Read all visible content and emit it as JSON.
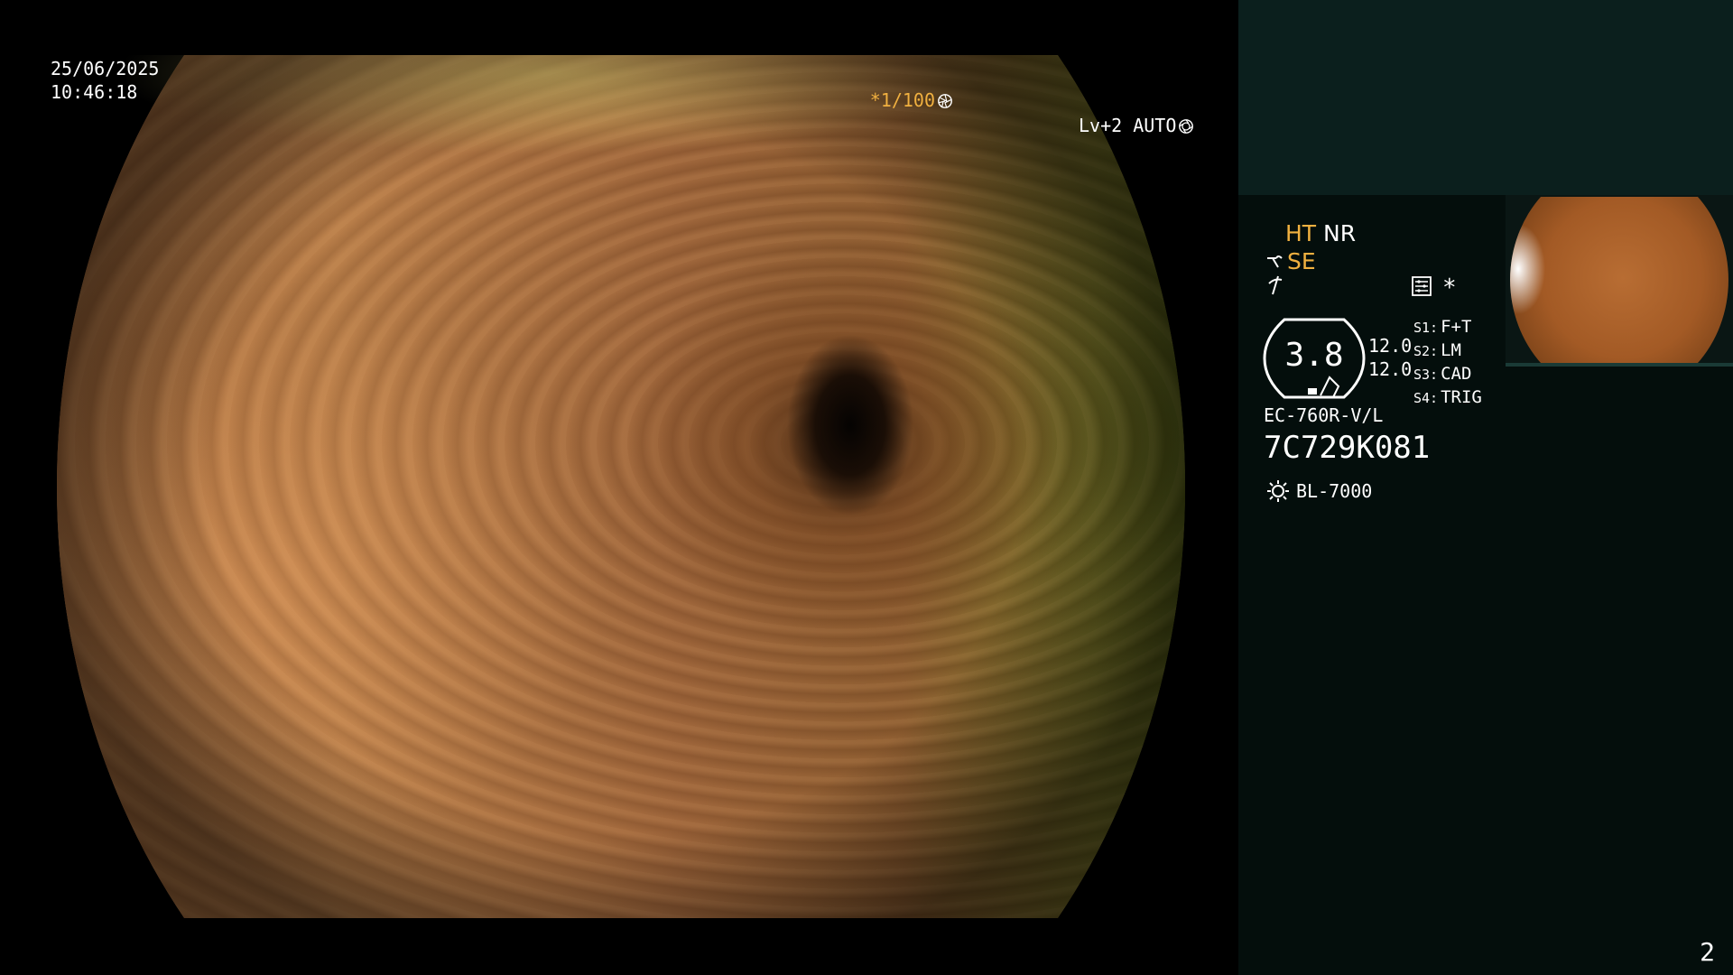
{
  "osd": {
    "date": "25/06/2025",
    "time": "10:46:18",
    "shutter": "*1/100",
    "level": "Lv+2 AUTO",
    "shutter_icon": "aperture-icon",
    "level_icon": "iris-icon"
  },
  "panel": {
    "ht": "HT",
    "nr": "NR",
    "se": "SE",
    "gauge_value": "3.8",
    "gain_1": "12.0",
    "gain_2": "12.0",
    "switches": [
      {
        "key": "S1:",
        "value": "F+T"
      },
      {
        "key": "S2:",
        "value": "LM"
      },
      {
        "key": "S3:",
        "value": "CAD"
      },
      {
        "key": "S4:",
        "value": "TRIG"
      }
    ],
    "model": "EC-760R-V/L",
    "serial": "7C729K081",
    "light_source": "BL-7000"
  },
  "page_number": "2",
  "colors": {
    "accent_orange": "#f0b040",
    "panel_bg": "#040e0c",
    "panel_top_bg": "#0b1f1d"
  }
}
